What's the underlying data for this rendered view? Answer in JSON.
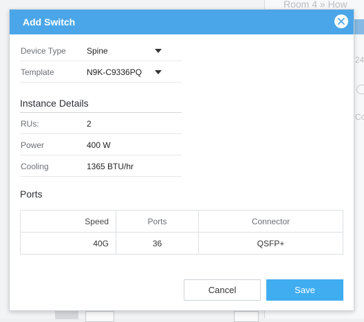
{
  "background": {
    "breadcrumb": "Room 4 » How",
    "side_text_1": "24",
    "side_text_2": "Co"
  },
  "modal": {
    "title": "Add Switch",
    "fields": [
      {
        "label": "Device Type",
        "value": "Spine"
      },
      {
        "label": "Template",
        "value": "N9K-C9336PQ"
      }
    ],
    "instance_details": {
      "title": "Instance Details",
      "rows": [
        {
          "label": "RUs:",
          "value": "2"
        },
        {
          "label": "Power",
          "value": "400 W"
        },
        {
          "label": "Cooling",
          "value": "1365 BTU/hr"
        }
      ]
    },
    "ports": {
      "title": "Ports",
      "columns": [
        "Speed",
        "Ports",
        "Connector"
      ],
      "rows": [
        [
          "40G",
          "36",
          "QSFP+"
        ]
      ]
    },
    "buttons": {
      "cancel": "Cancel",
      "save": "Save"
    }
  },
  "colors": {
    "header": "#4aa6e8",
    "save": "#40adf0"
  },
  "icons": {
    "close": "close-icon",
    "dropdown": "chevron-down-icon"
  }
}
